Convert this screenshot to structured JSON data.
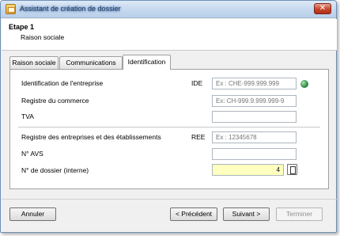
{
  "window": {
    "title": "Assistant de création de dossier",
    "close_glyph": "✕"
  },
  "header": {
    "step_title": "Etape 1",
    "step_subtitle": "Raison sociale"
  },
  "tabs": [
    {
      "label": "Raison sociale",
      "active": false
    },
    {
      "label": "Communications",
      "active": false
    },
    {
      "label": "Identification",
      "active": true
    }
  ],
  "form": {
    "ide": {
      "label": "Identification de l'entreprise",
      "code": "IDE",
      "placeholder": "Ex : CHE-999.999.999",
      "value": ""
    },
    "registre_commerce": {
      "label": "Registre du commerce",
      "placeholder": "Ex: CH-999.9.999.999-9",
      "value": ""
    },
    "tva": {
      "label": "TVA",
      "value": ""
    },
    "ree": {
      "label": "Registre des entreprises et des établissements",
      "code": "REE",
      "placeholder": "Ex : 12345678",
      "value": ""
    },
    "avs": {
      "label": "N° AVS",
      "value": ""
    },
    "dossier": {
      "label": "N° de dossier (interne)",
      "value": "4"
    }
  },
  "icons": {
    "globe": "globe-icon",
    "document": "document-icon",
    "app": "app-icon"
  },
  "buttons": {
    "cancel": "Annuler",
    "previous": "< Précédent",
    "next": "Suivant >",
    "finish": "Terminer"
  }
}
